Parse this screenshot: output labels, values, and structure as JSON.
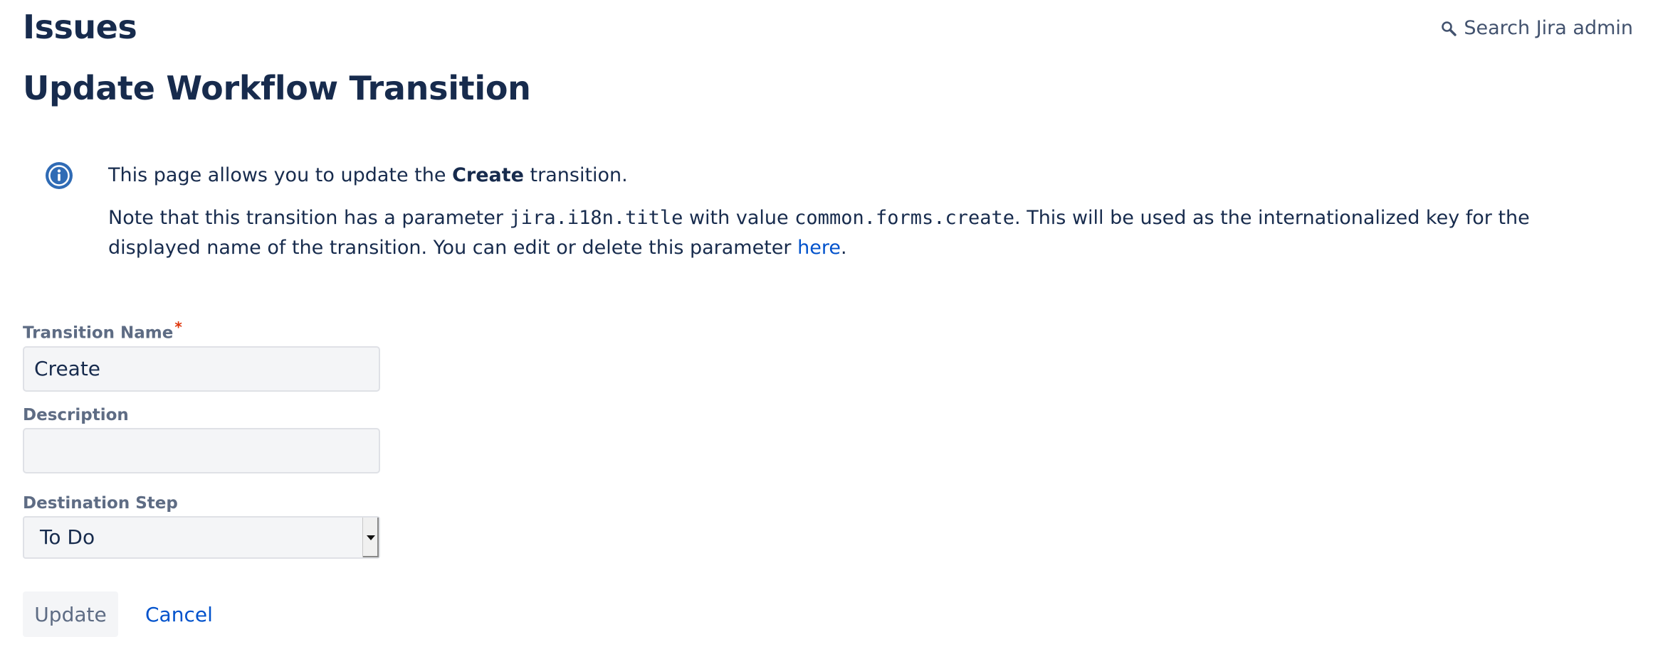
{
  "header": {
    "title": "Issues",
    "search_label": "Search Jira admin",
    "search_icon": "search-icon"
  },
  "page_title": "Update Workflow Transition",
  "info": {
    "icon": "info-icon",
    "line1_prefix": "This page allows you to update the ",
    "line1_bold": "Create",
    "line1_suffix": " transition.",
    "line2_part1": "Note that this transition has a parameter ",
    "line2_code1": "jira.i18n.title",
    "line2_part2": " with value ",
    "line2_code2": "common.forms.create",
    "line2_part3": ". This will be used as the internationalized key for the displayed name of the transition. You can edit or delete this parameter ",
    "line2_link": "here",
    "line2_end": "."
  },
  "form": {
    "transition_name_label": "Transition Name",
    "required_mark": "*",
    "transition_name_value": "Create",
    "description_label": "Description",
    "description_value": "",
    "destination_label": "Destination Step",
    "destination_value": "To Do",
    "update_button": "Update",
    "cancel_link": "Cancel"
  },
  "colors": {
    "heading": "#172b4d",
    "link": "#0052cc",
    "label": "#5e6c84",
    "info_icon": "#2f6bb5",
    "required": "#de350b"
  }
}
